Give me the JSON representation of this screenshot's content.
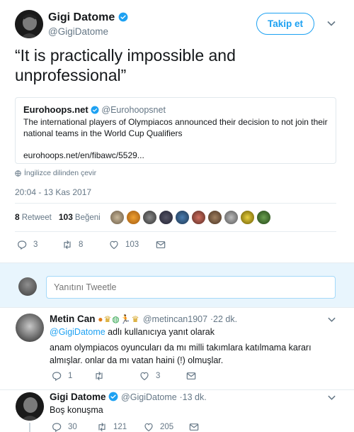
{
  "main": {
    "name": "Gigi Datome",
    "handle": "@GigiDatome",
    "follow_label": "Takip et",
    "text": "“It is practically impossible and unprofessional”",
    "quote": {
      "name": "Eurohoops.net",
      "handle": "@Eurohoopsnet",
      "text": "The international players of Olympiacos announced their decision to not join their national teams in the World Cup Qualifiers",
      "link": "eurohoops.net/en/fibawc/5529..."
    },
    "translate_label": "İngilizce dilinden çevir",
    "timestamp": "20:04 - 13 Kas 2017",
    "stats": {
      "retweets": "8",
      "retweets_label": "Retweet",
      "likes": "103",
      "likes_label": "Beğeni"
    },
    "actions": {
      "replies": "3",
      "retweets": "8",
      "likes": "103"
    }
  },
  "composer": {
    "placeholder": "Yanıtını Tweetle"
  },
  "replies": [
    {
      "name": "Metin Can",
      "handle": "@metincan1907",
      "time": "·22 dk.",
      "emojis": [
        "basketball",
        "trophy",
        "globe",
        "runner",
        "trophy"
      ],
      "reply_to_prefix": "@GigiDatome",
      "reply_to_suffix": "adlı kullanıcıya yanıt olarak",
      "text": "anam olympiacos oyuncuları da mı milli takımlara katılmama kararı almışlar. onlar da mı vatan haini (!) olmuşlar.",
      "counts": {
        "replies": "1",
        "retweets": "",
        "likes": "3"
      }
    },
    {
      "name": "Gigi Datome",
      "handle": "@GigiDatome",
      "time": "·13 dk.",
      "text": "Boş konuşma",
      "counts": {
        "replies": "30",
        "retweets": "121",
        "likes": "205"
      }
    }
  ],
  "colors": {
    "accent": "#1da1f2",
    "muted": "#657786",
    "composer_bg": "#e8f5fd"
  }
}
